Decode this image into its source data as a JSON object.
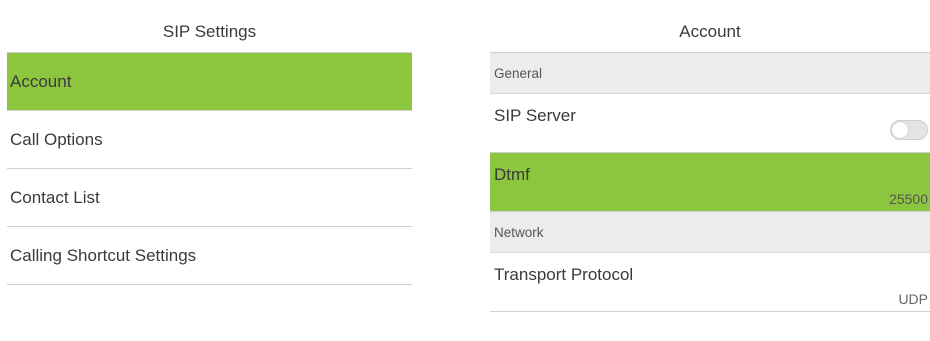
{
  "left_panel": {
    "title": "SIP Settings",
    "items": [
      {
        "label": "Account"
      },
      {
        "label": "Call Options"
      },
      {
        "label": "Contact List"
      },
      {
        "label": "Calling Shortcut Settings"
      }
    ],
    "selected_index": 0
  },
  "right_panel": {
    "title": "Account",
    "sections": {
      "general": "General",
      "network": "Network"
    },
    "rows": {
      "sip_server": {
        "label": "SIP Server",
        "toggle": "off"
      },
      "dtmf": {
        "label": "Dtmf",
        "value": "25500"
      },
      "transport_protocol": {
        "label": "Transport Protocol",
        "value": "UDP"
      }
    }
  },
  "colors": {
    "accent": "#8cc63f",
    "section_bg": "#ececec",
    "divider": "#cfcfcf"
  }
}
